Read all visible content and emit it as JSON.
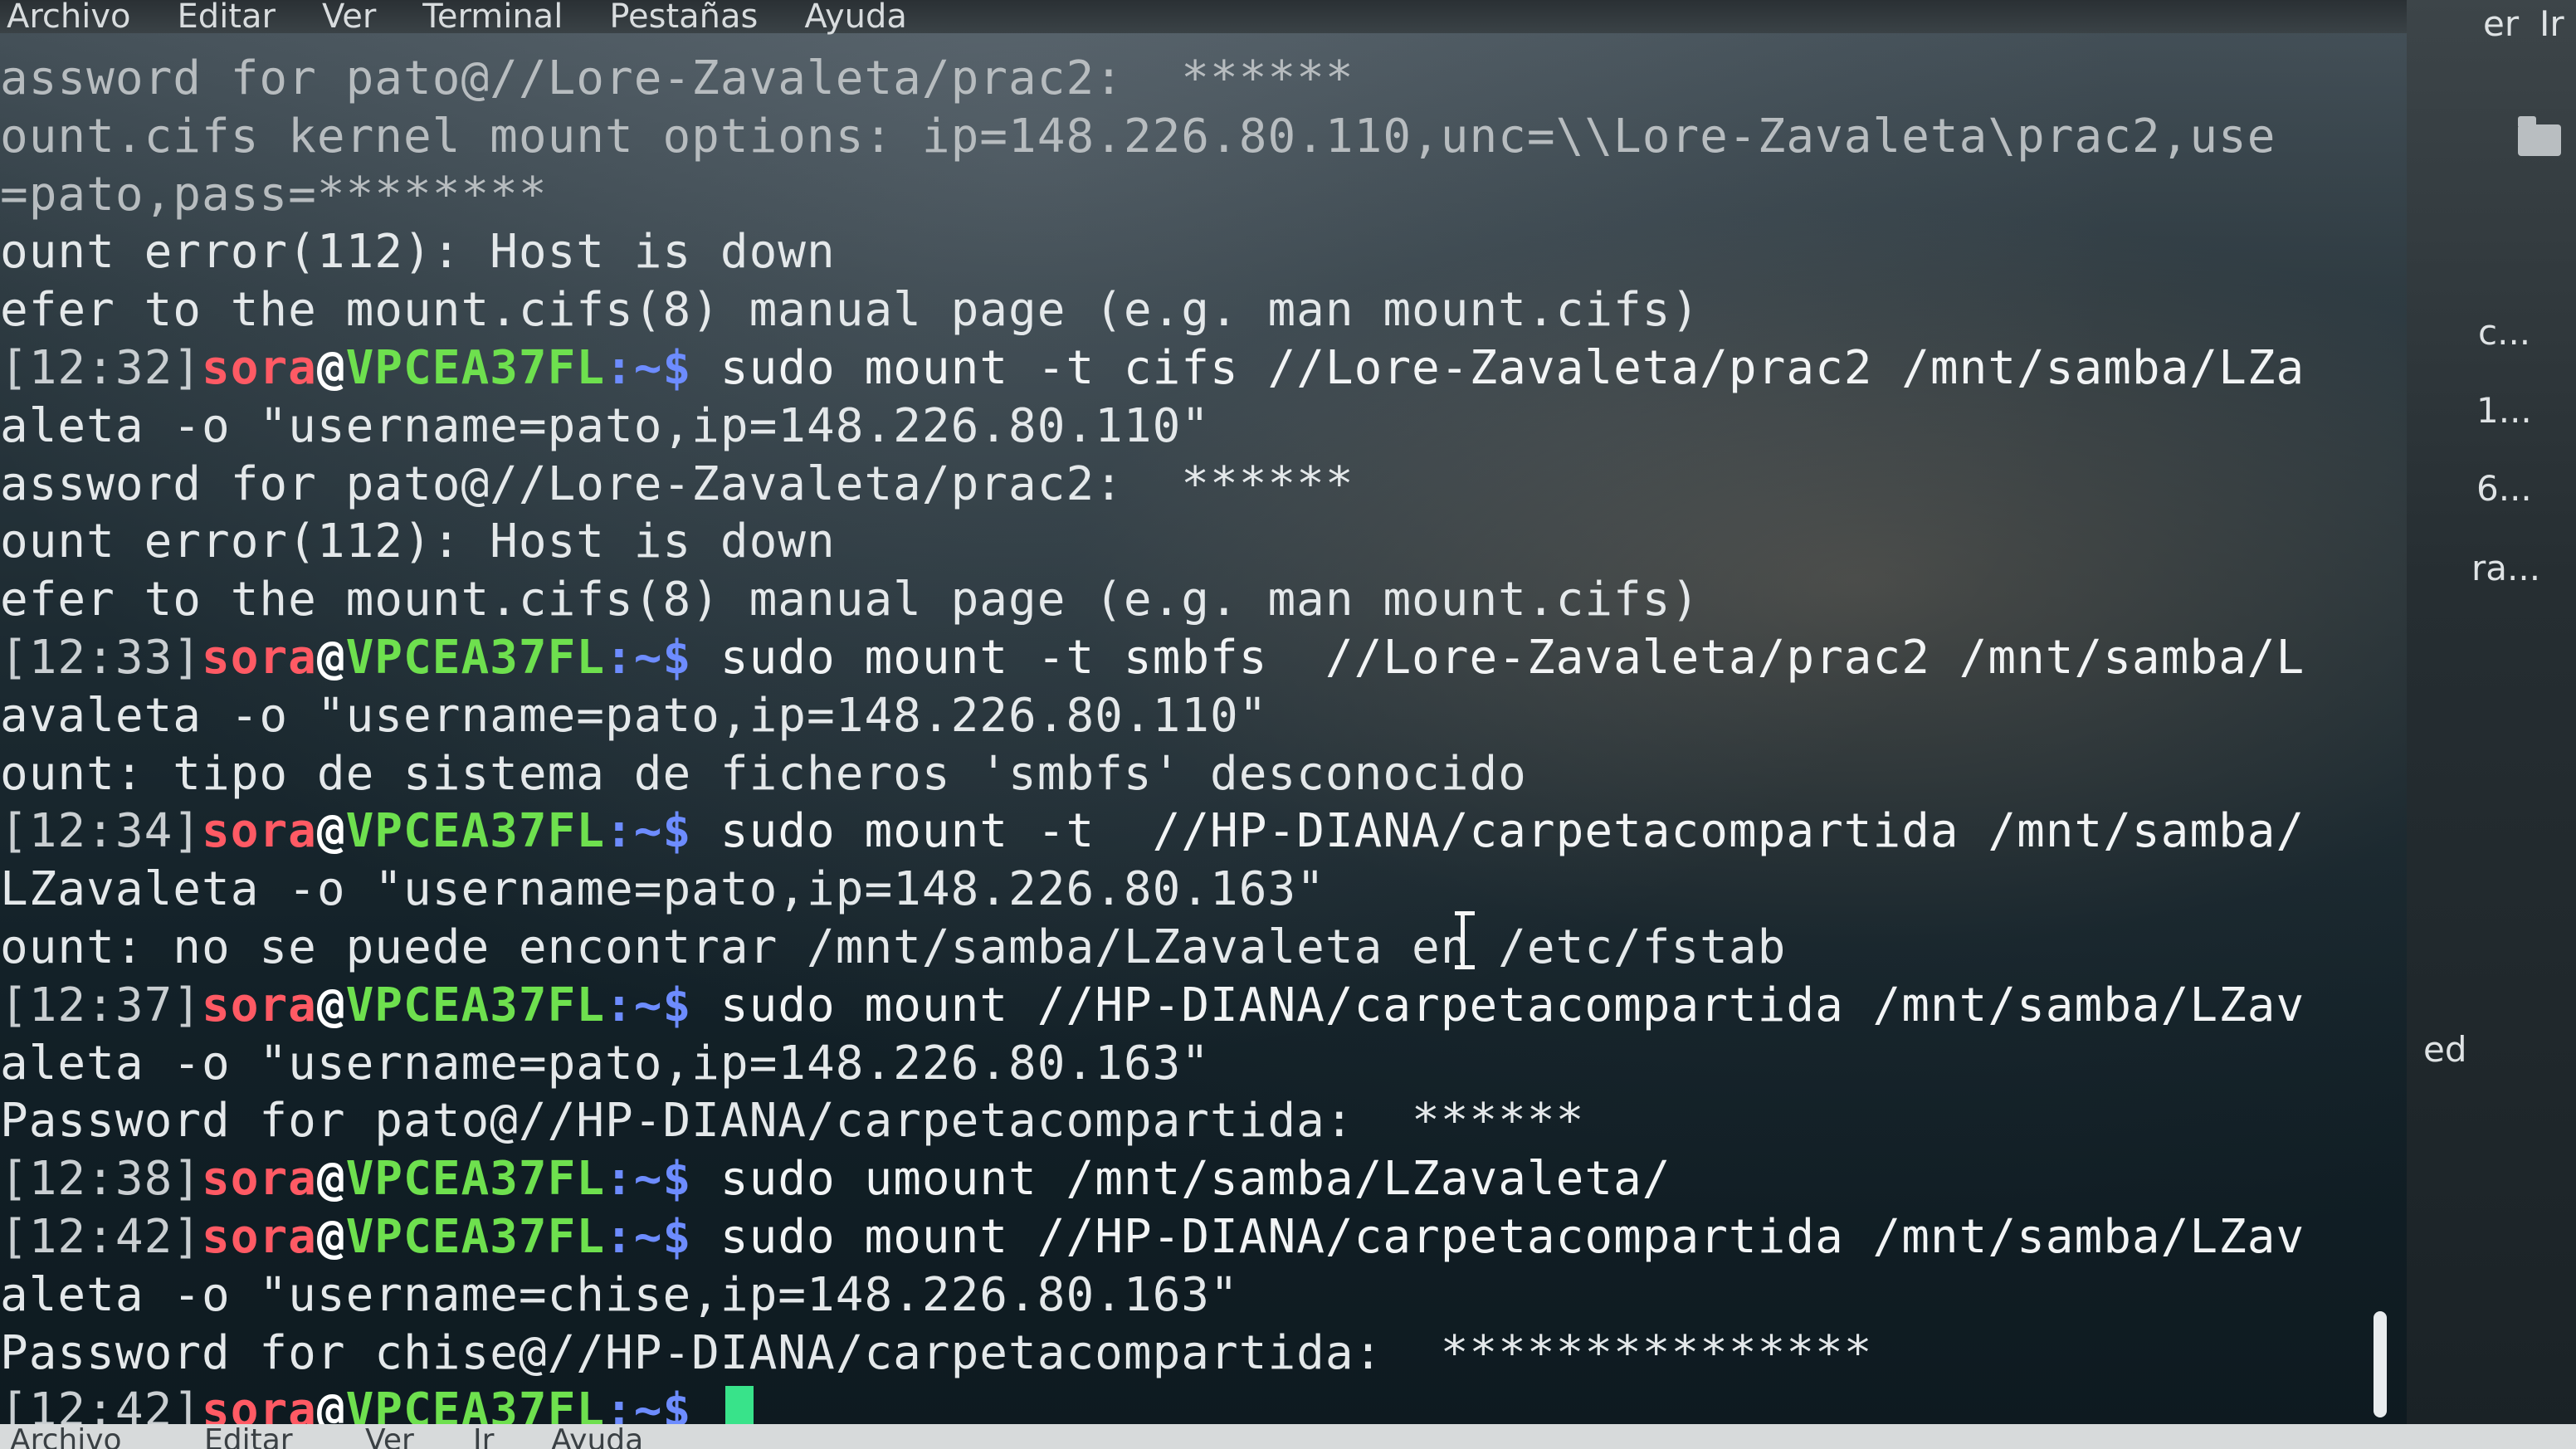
{
  "menubar": {
    "items": [
      "Archivo",
      "Editar",
      "Ver",
      "Terminal",
      "Pestañas",
      "Ayuda"
    ]
  },
  "terminal": {
    "lines": [
      {
        "text": "assword for pato@//Lore-Zavaleta/prac2:  ******"
      },
      {
        "text": "ount.cifs kernel mount options: ip=148.226.80.110,unc=\\\\Lore-Zavaleta\\prac2,use"
      },
      {
        "text": "=pato,pass=********"
      },
      {
        "text": "ount error(112): Host is down"
      },
      {
        "text": "efer to the mount.cifs(8) manual page (e.g. man mount.cifs)"
      },
      {
        "ts": "[12:32]",
        "user": "sora",
        "at": "@",
        "host": "VPCEA37FL",
        "path": ":~$",
        "cmd": " sudo mount -t cifs //Lore-Zavaleta/prac2 /mnt/samba/LZa"
      },
      {
        "text": "aleta -o \"username=pato,ip=148.226.80.110\""
      },
      {
        "text": "assword for pato@//Lore-Zavaleta/prac2:  ******"
      },
      {
        "text": "ount error(112): Host is down"
      },
      {
        "text": "efer to the mount.cifs(8) manual page (e.g. man mount.cifs)"
      },
      {
        "ts": "[12:33]",
        "user": "sora",
        "at": "@",
        "host": "VPCEA37FL",
        "path": ":~$",
        "cmd": " sudo mount -t smbfs  //Lore-Zavaleta/prac2 /mnt/samba/L"
      },
      {
        "text": "avaleta -o \"username=pato,ip=148.226.80.110\""
      },
      {
        "text": "ount: tipo de sistema de ficheros 'smbfs' desconocido"
      },
      {
        "ts": "[12:34]",
        "user": "sora",
        "at": "@",
        "host": "VPCEA37FL",
        "path": ":~$",
        "cmd": " sudo mount -t  //HP-DIANA/carpetacompartida /mnt/samba/"
      },
      {
        "text": "LZavaleta -o \"username=pato,ip=148.226.80.163\""
      },
      {
        "text": "ount: no se puede encontrar /mnt/samba/LZavaleta en /etc/fstab"
      },
      {
        "ts": "[12:37]",
        "user": "sora",
        "at": "@",
        "host": "VPCEA37FL",
        "path": ":~$",
        "cmd": " sudo mount //HP-DIANA/carpetacompartida /mnt/samba/LZav"
      },
      {
        "text": "aleta -o \"username=pato,ip=148.226.80.163\""
      },
      {
        "text": "Password for pato@//HP-DIANA/carpetacompartida:  ******"
      },
      {
        "ts": "[12:38]",
        "user": "sora",
        "at": "@",
        "host": "VPCEA37FL",
        "path": ":~$",
        "cmd": " sudo umount /mnt/samba/LZavaleta/"
      },
      {
        "ts": "[12:42]",
        "user": "sora",
        "at": "@",
        "host": "VPCEA37FL",
        "path": ":~$",
        "cmd": " sudo mount //HP-DIANA/carpetacompartida /mnt/samba/LZav"
      },
      {
        "text": "aleta -o \"username=chise,ip=148.226.80.163\""
      },
      {
        "text": "Password for chise@//HP-DIANA/carpetacompartida:  ***************"
      },
      {
        "ts": "[12:42]",
        "user": "sora",
        "at": "@",
        "host": "VPCEA37FL",
        "path": ":~$",
        "cmd": " "
      }
    ]
  },
  "side_panel": {
    "items": [
      "er",
      "Ir",
      "c...",
      "1...",
      "6...",
      "ra...",
      "ed"
    ]
  },
  "bottombar": {
    "items": [
      "Archivo",
      "Editar",
      "Ver",
      "Ir",
      "Ayuda"
    ]
  },
  "colors": {
    "user": "#ff5a64",
    "host": "#6ee04e",
    "path": "#6d8cff",
    "cursor": "#38e38a"
  }
}
